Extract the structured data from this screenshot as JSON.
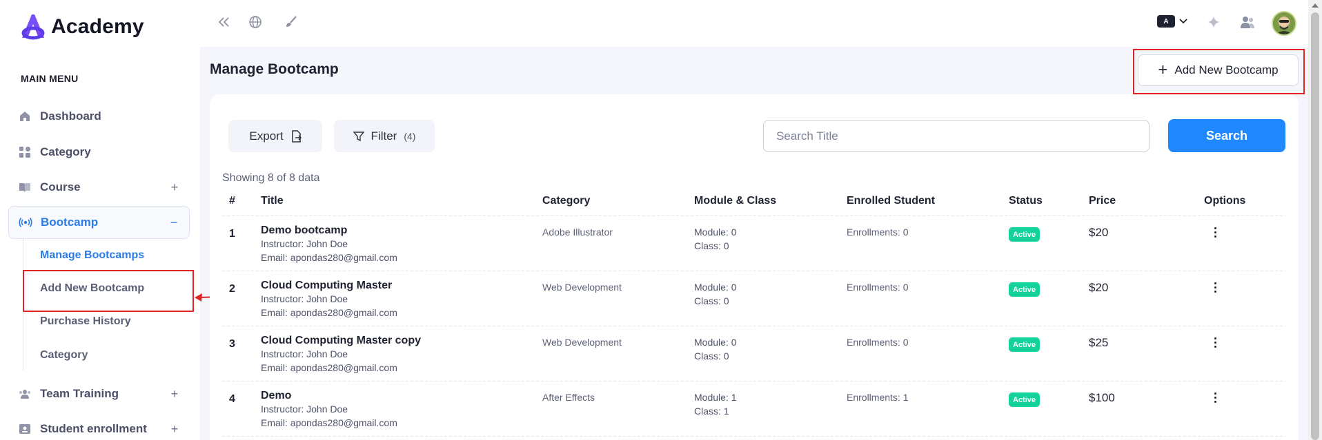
{
  "brand": {
    "name": "Academy"
  },
  "sidebar": {
    "heading": "MAIN MENU",
    "items": [
      {
        "label": "Dashboard",
        "icon": "home-icon",
        "toggle": ""
      },
      {
        "label": "Category",
        "icon": "grid-icon",
        "toggle": ""
      },
      {
        "label": "Course",
        "icon": "book-icon",
        "toggle": "+"
      },
      {
        "label": "Bootcamp",
        "icon": "broadcast-icon",
        "toggle": "−"
      },
      {
        "label": "Team Training",
        "icon": "team-icon",
        "toggle": "+"
      },
      {
        "label": "Student enrollment",
        "icon": "id-card-icon",
        "toggle": "+"
      }
    ],
    "submenu": [
      {
        "label": "Manage Bootcamps"
      },
      {
        "label": "Add New Bootcamp"
      },
      {
        "label": "Purchase History"
      },
      {
        "label": "Category"
      }
    ]
  },
  "topbar": {
    "icons": [
      "collapse-icon",
      "globe-icon",
      "brush-icon",
      "sparkle-icon",
      "users-icon"
    ],
    "language_badge": "A"
  },
  "page": {
    "title": "Manage Bootcamp",
    "add_button": "Add New Bootcamp"
  },
  "toolbar": {
    "export_label": "Export",
    "filter_label": "Filter",
    "filter_count": "(4)",
    "search_placeholder": "Search Title",
    "search_button": "Search"
  },
  "table": {
    "showing": "Showing 8 of 8 data",
    "headers": [
      "#",
      "Title",
      "Category",
      "Module & Class",
      "Enrolled Student",
      "Status",
      "Price",
      "Options"
    ],
    "rows": [
      {
        "num": "1",
        "title": "Demo bootcamp",
        "instructor": "Instructor: John Doe",
        "email": "Email: apondas280@gmail.com",
        "category": "Adobe Illustrator",
        "module": "Module: 0",
        "class": "Class: 0",
        "enrollments": "Enrollments: 0",
        "status": "Active",
        "price": "$20"
      },
      {
        "num": "2",
        "title": "Cloud Computing Master",
        "instructor": "Instructor: John Doe",
        "email": "Email: apondas280@gmail.com",
        "category": "Web Development",
        "module": "Module: 0",
        "class": "Class: 0",
        "enrollments": "Enrollments: 0",
        "status": "Active",
        "price": "$20"
      },
      {
        "num": "3",
        "title": "Cloud Computing Master copy",
        "instructor": "Instructor: John Doe",
        "email": "Email: apondas280@gmail.com",
        "category": "Web Development",
        "module": "Module: 0",
        "class": "Class: 0",
        "enrollments": "Enrollments: 0",
        "status": "Active",
        "price": "$25"
      },
      {
        "num": "4",
        "title": "Demo",
        "instructor": "Instructor: John Doe",
        "email": "Email: apondas280@gmail.com",
        "category": "After Effects",
        "module": "Module: 1",
        "class": "Class: 1",
        "enrollments": "Enrollments: 1",
        "status": "Active",
        "price": "$100"
      }
    ]
  },
  "colors": {
    "accent": "#1f88ff",
    "active_nav": "#2b7be4",
    "status_active": "#15d29b",
    "annotation": "#e02424"
  }
}
